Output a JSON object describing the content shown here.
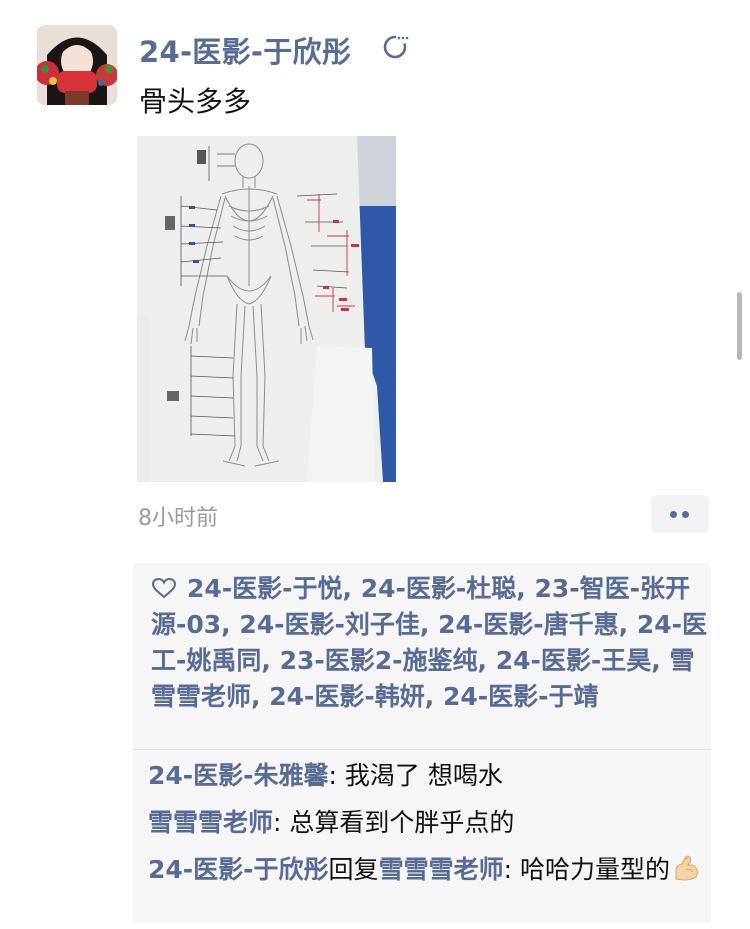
{
  "post": {
    "author": "24-医影-于欣彤",
    "text": "骨头多多",
    "time": "8小时前"
  },
  "likes": {
    "names": "24-医影-于悦, 24-医影-杜聪, 23-智医-张开源-03, 24-医影-刘子佳, 24-医影-唐千惠, 24-医工-姚禹同, 23-医影2-施鉴纯, 24-医影-王昊, 雪雪雪老师, 24-医影-韩妍, 24-医影-于靖"
  },
  "comments": [
    {
      "author": "24-医影-朱雅馨",
      "sep": ": ",
      "text": "我渴了 想喝水"
    },
    {
      "author": "雪雪雪老师",
      "sep": ": ",
      "text": "总算看到个胖乎点的"
    },
    {
      "author": "24-医影-于欣彤",
      "reply_word": "回复",
      "reply_to": "雪雪雪老师",
      "sep": ": ",
      "text": "哈哈力量型的"
    }
  ],
  "icons": {
    "status": "status-ring-icon",
    "like": "heart-icon",
    "more": "more-dots-icon",
    "emoji": "flexed-biceps-emoji"
  },
  "colors": {
    "link": "#576b95",
    "text": "#111111",
    "meta": "#9a9a9a",
    "panel": "#f6f6f6"
  }
}
